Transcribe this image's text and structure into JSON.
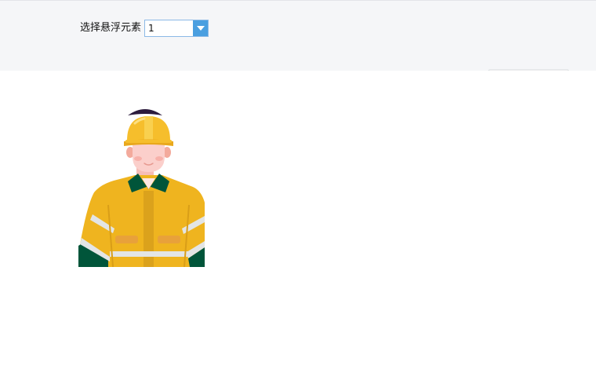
{
  "toolbar": {
    "selector_label": "选择悬浮元素",
    "selected_value": "1",
    "arrow_icon": "chevron-down-icon",
    "collapse_icon": "caret-up-icon"
  },
  "canvas": {
    "floating_element": "construction-worker-illustration"
  },
  "colors": {
    "toolbar_bg": "#f5f6f8",
    "select_border": "#8cb9e6",
    "select_arrow_bg": "#4a9fe0",
    "helmet": "#f6be2c",
    "jacket": "#efb41f",
    "jacket_dark": "#00553a",
    "reflective": "#e3e5e5",
    "skin": "#fbcfcb",
    "hair": "#2c1b3d"
  }
}
